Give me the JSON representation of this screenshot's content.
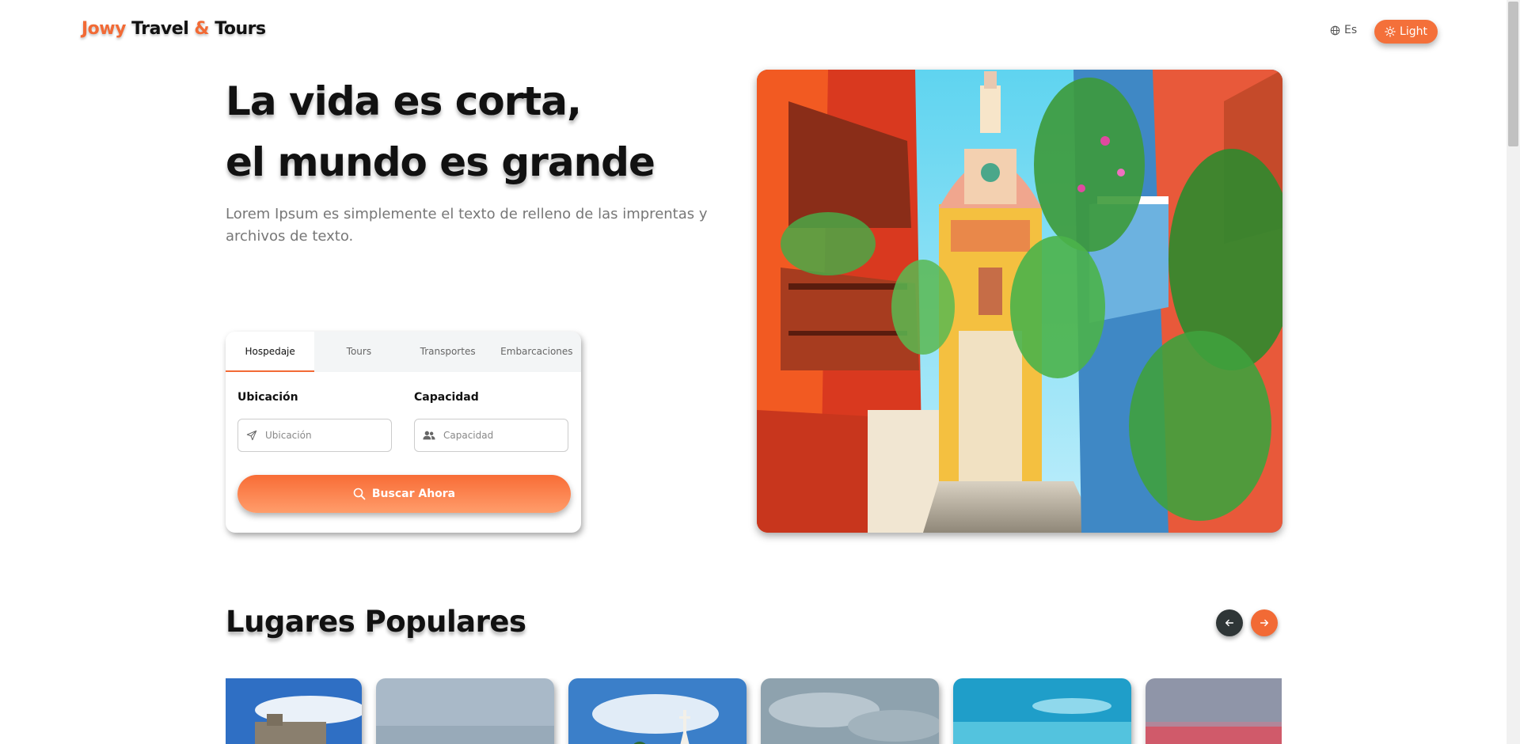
{
  "brand": {
    "part1": "Jowy",
    "part2": "Travel",
    "amp": "&",
    "part3": "Tours"
  },
  "header": {
    "lang_label": "Es",
    "lang_icon": "globe-icon",
    "theme_label": "Light",
    "theme_icon": "sun-icon"
  },
  "hero": {
    "title_line1": "La vida es corta,",
    "title_line2": "el mundo es grande",
    "subtitle": "Lorem Ipsum es simplemente el texto de relleno de las imprentas y archivos de texto."
  },
  "search": {
    "tabs": [
      {
        "label": "Hospedaje",
        "active": true
      },
      {
        "label": "Tours",
        "active": false
      },
      {
        "label": "Transportes",
        "active": false
      },
      {
        "label": "Embarcaciones",
        "active": false
      }
    ],
    "location_label": "Ubicación",
    "location_placeholder": "Ubicación",
    "location_icon": "send-icon",
    "capacity_label": "Capacidad",
    "capacity_placeholder": "Capacidad",
    "capacity_icon": "users-icon",
    "button_label": "Buscar Ahora",
    "button_icon": "search-icon"
  },
  "popular": {
    "title": "Lugares Populares",
    "prev_icon": "arrow-left-icon",
    "next_icon": "arrow-right-icon",
    "cards_count": 6
  },
  "colors": {
    "accent": "#f26a35",
    "dark_button": "#2f3637"
  }
}
